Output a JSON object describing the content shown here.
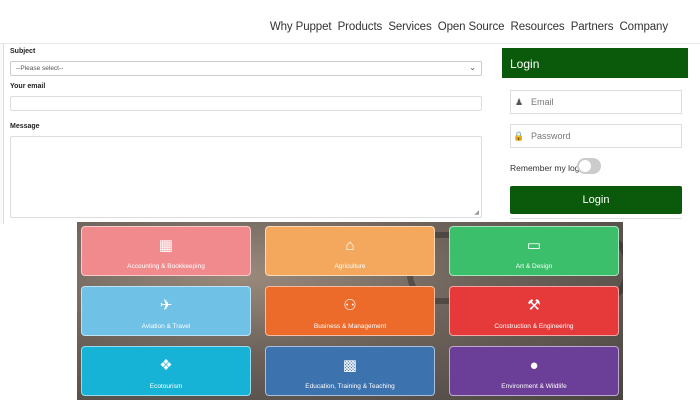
{
  "nav": {
    "items": [
      "Why Puppet",
      "Products",
      "Services",
      "Open Source",
      "Resources",
      "Partners",
      "Company"
    ]
  },
  "form": {
    "subject_label": "Subject",
    "subject_value": "--Please select--",
    "email_label": "Your email",
    "message_label": "Message"
  },
  "login": {
    "title": "Login",
    "email_placeholder": "Email",
    "password_placeholder": "Password",
    "remember_label": "Remember my login",
    "button_label": "Login",
    "accent": "#0b5a0b"
  },
  "categories": [
    {
      "label": "Accounting & Bookkeeping",
      "icon": "calculator-icon",
      "color": "#f08a8c"
    },
    {
      "label": "Agriculture",
      "icon": "barn-icon",
      "color": "#f3a85e"
    },
    {
      "label": "Art & Design",
      "icon": "monitor-icon",
      "color": "#3bbf6a"
    },
    {
      "label": "Aviation & Travel",
      "icon": "airplane-icon",
      "color": "#6fc1e6"
    },
    {
      "label": "Business & Management",
      "icon": "team-chart-icon",
      "color": "#ec6a2a"
    },
    {
      "label": "Construction & Engineering",
      "icon": "hammer-icon",
      "color": "#e63a3a"
    },
    {
      "label": "Ecotourism",
      "icon": "map-icon",
      "color": "#16b3d6"
    },
    {
      "label": "Education, Training & Teaching",
      "icon": "presentation-icon",
      "color": "#3c72ad"
    },
    {
      "label": "Environment & Wildlife",
      "icon": "globe-icon",
      "color": "#6b3f97"
    }
  ]
}
